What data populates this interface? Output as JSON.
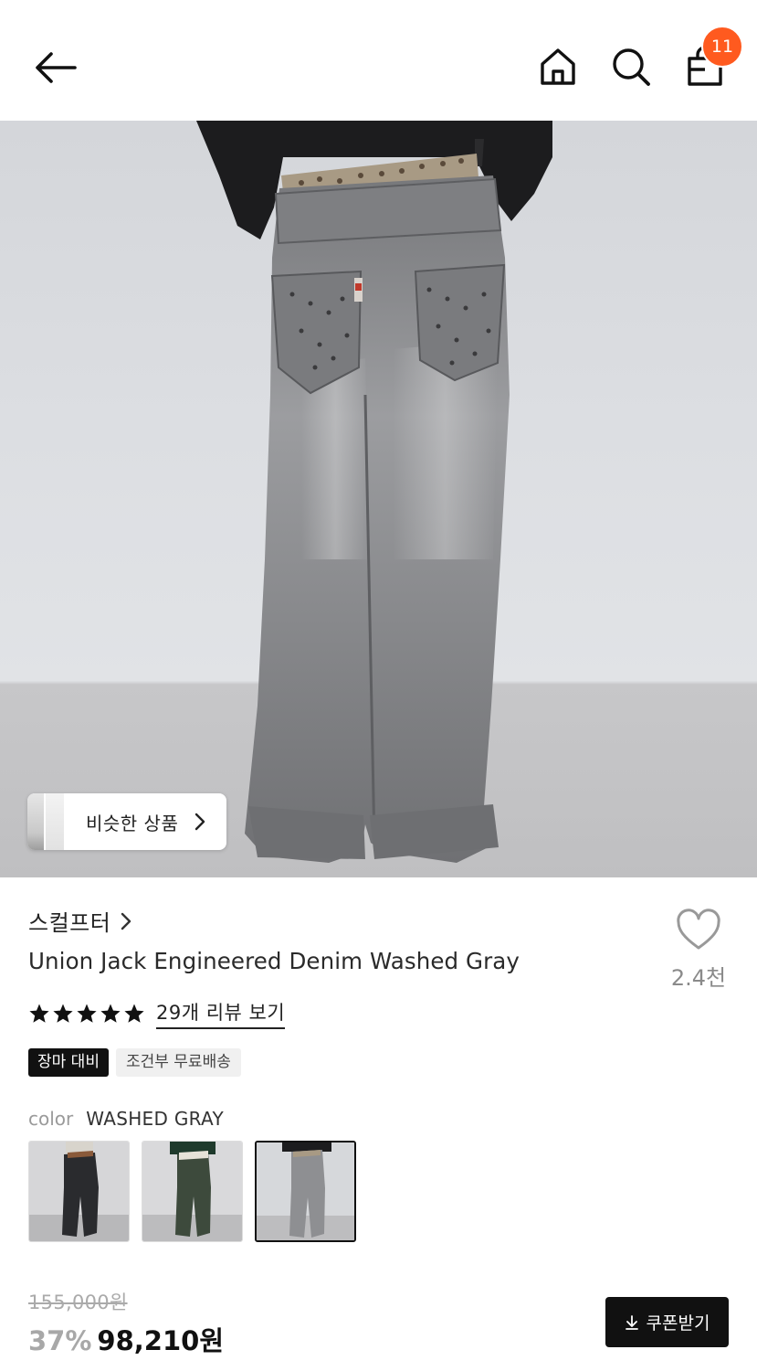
{
  "header": {
    "back_icon": "arrow-left-icon",
    "home_icon": "home-icon",
    "search_icon": "search-icon",
    "cart_icon": "shopping-bag-icon",
    "cart_count": "11",
    "badge_color": "#ff5a1f"
  },
  "hero": {
    "image": "product-photo-gray-flared-jeans",
    "similar_button_label": "비슷한 상품"
  },
  "product": {
    "brand": "스컬프터",
    "title": "Union Jack Engineered Denim Washed Gray",
    "like_count": "2.4천",
    "rating_stars": 5,
    "review_link": "29개 리뷰 보기",
    "badges": [
      "장마 대비",
      "조건부 무료배송"
    ],
    "color_label": "color",
    "color_value": "WASHED GRAY",
    "swatches": [
      "black-denim",
      "green-denim",
      "washed-gray-denim"
    ],
    "selected_swatch": "washed-gray-denim"
  },
  "price": {
    "original": "155,000원",
    "discount": "37%",
    "sale": "98,210원",
    "coupon_label": "쿠폰받기"
  }
}
